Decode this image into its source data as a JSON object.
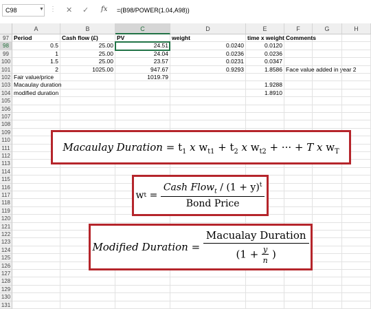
{
  "formula_bar": {
    "namebox": "C98",
    "formula": "=(B98/POWER(1.04,A98))"
  },
  "columns": [
    "A",
    "B",
    "C",
    "D",
    "E",
    "F",
    "G",
    "H"
  ],
  "rows": [
    {
      "num": "97",
      "cells": [
        "Period",
        "Cash flow (£)",
        "PV",
        "weight",
        "time x weight",
        "Comments",
        "",
        ""
      ]
    },
    {
      "num": "98",
      "cells": [
        "0.5",
        "25.00",
        "24.51",
        "0.0240",
        "0.0120",
        "",
        "",
        ""
      ]
    },
    {
      "num": "99",
      "cells": [
        "1",
        "25.00",
        "24.04",
        "0.0236",
        "0.0236",
        "",
        "",
        ""
      ]
    },
    {
      "num": "100",
      "cells": [
        "1.5",
        "25.00",
        "23.57",
        "0.0231",
        "0.0347",
        "",
        "",
        ""
      ]
    },
    {
      "num": "101",
      "cells": [
        "2",
        "1025.00",
        "947.67",
        "0.9293",
        "1.8586",
        "Face value added in year 2",
        "",
        ""
      ]
    },
    {
      "num": "102",
      "cells": [
        "Fair value/price",
        "",
        "1019.79",
        "",
        "",
        "",
        "",
        ""
      ]
    },
    {
      "num": "103",
      "cells": [
        "Macaulay duration",
        "",
        "",
        "",
        "1.9288",
        "",
        "",
        ""
      ]
    },
    {
      "num": "104",
      "cells": [
        "modified duration",
        "",
        "",
        "",
        "1.8910",
        "",
        "",
        ""
      ]
    },
    {
      "num": "105",
      "cells": [
        "",
        "",
        "",
        "",
        "",
        "",
        "",
        ""
      ]
    },
    {
      "num": "106",
      "cells": [
        "",
        "",
        "",
        "",
        "",
        "",
        "",
        ""
      ]
    },
    {
      "num": "107",
      "cells": [
        "",
        "",
        "",
        "",
        "",
        "",
        "",
        ""
      ]
    },
    {
      "num": "108",
      "cells": [
        "",
        "",
        "",
        "",
        "",
        "",
        "",
        ""
      ]
    },
    {
      "num": "109",
      "cells": [
        "",
        "",
        "",
        "",
        "",
        "",
        "",
        ""
      ]
    },
    {
      "num": "110",
      "cells": [
        "",
        "",
        "",
        "",
        "",
        "",
        "",
        ""
      ]
    },
    {
      "num": "111",
      "cells": [
        "",
        "",
        "",
        "",
        "",
        "",
        "",
        ""
      ]
    },
    {
      "num": "112",
      "cells": [
        "",
        "",
        "",
        "",
        "",
        "",
        "",
        ""
      ]
    },
    {
      "num": "113",
      "cells": [
        "",
        "",
        "",
        "",
        "",
        "",
        "",
        ""
      ]
    },
    {
      "num": "114",
      "cells": [
        "",
        "",
        "",
        "",
        "",
        "",
        "",
        ""
      ]
    },
    {
      "num": "115",
      "cells": [
        "",
        "",
        "",
        "",
        "",
        "",
        "",
        ""
      ]
    },
    {
      "num": "116",
      "cells": [
        "",
        "",
        "",
        "",
        "",
        "",
        "",
        ""
      ]
    },
    {
      "num": "117",
      "cells": [
        "",
        "",
        "",
        "",
        "",
        "",
        "",
        ""
      ]
    },
    {
      "num": "118",
      "cells": [
        "",
        "",
        "",
        "",
        "",
        "",
        "",
        ""
      ]
    },
    {
      "num": "119",
      "cells": [
        "",
        "",
        "",
        "",
        "",
        "",
        "",
        ""
      ]
    },
    {
      "num": "120",
      "cells": [
        "",
        "",
        "",
        "",
        "",
        "",
        "",
        ""
      ]
    },
    {
      "num": "121",
      "cells": [
        "",
        "",
        "",
        "",
        "",
        "",
        "",
        ""
      ]
    },
    {
      "num": "122",
      "cells": [
        "",
        "",
        "",
        "",
        "",
        "",
        "",
        ""
      ]
    },
    {
      "num": "123",
      "cells": [
        "",
        "",
        "",
        "",
        "",
        "",
        "",
        ""
      ]
    },
    {
      "num": "124",
      "cells": [
        "",
        "",
        "",
        "",
        "",
        "",
        "",
        ""
      ]
    },
    {
      "num": "125",
      "cells": [
        "",
        "",
        "",
        "",
        "",
        "",
        "",
        ""
      ]
    },
    {
      "num": "126",
      "cells": [
        "",
        "",
        "",
        "",
        "",
        "",
        "",
        ""
      ]
    },
    {
      "num": "127",
      "cells": [
        "",
        "",
        "",
        "",
        "",
        "",
        "",
        ""
      ]
    },
    {
      "num": "128",
      "cells": [
        "",
        "",
        "",
        "",
        "",
        "",
        "",
        ""
      ]
    },
    {
      "num": "129",
      "cells": [
        "",
        "",
        "",
        "",
        "",
        "",
        "",
        ""
      ]
    },
    {
      "num": "130",
      "cells": [
        "",
        "",
        "",
        "",
        "",
        "",
        "",
        ""
      ]
    },
    {
      "num": "131",
      "cells": [
        "",
        "",
        "",
        "",
        "",
        "",
        "",
        ""
      ]
    }
  ],
  "selected_cell": {
    "col": "C",
    "row": "98"
  },
  "formulas": {
    "macaulay": {
      "lhs": "Macaulay Duration",
      "t1": "t",
      "w1": "w",
      "sub1": "t1",
      "t2": "t",
      "w2": "w",
      "sub2": "t2",
      "dots": "+ ··· +",
      "T": "T",
      "wT": "w",
      "subT": "T",
      "x": "x"
    },
    "weight": {
      "lhs": "w",
      "lhs_sub": "t",
      "num": "Cash Flow",
      "num_sub": "t",
      "num_rest": "/ (1 + y)",
      "num_sup": "t",
      "den": "Bond Price"
    },
    "modified": {
      "lhs": "Modified Duration",
      "num": "Macualay Duration",
      "den_open": "(1 +",
      "den_y": "y",
      "den_n": "n",
      "den_close": ")"
    }
  },
  "colors": {
    "selection": "#217346",
    "formula_border": "#b5252b",
    "header_bg": "#efefef"
  },
  "icons": [
    "close-icon",
    "check-icon",
    "fx-icon"
  ]
}
